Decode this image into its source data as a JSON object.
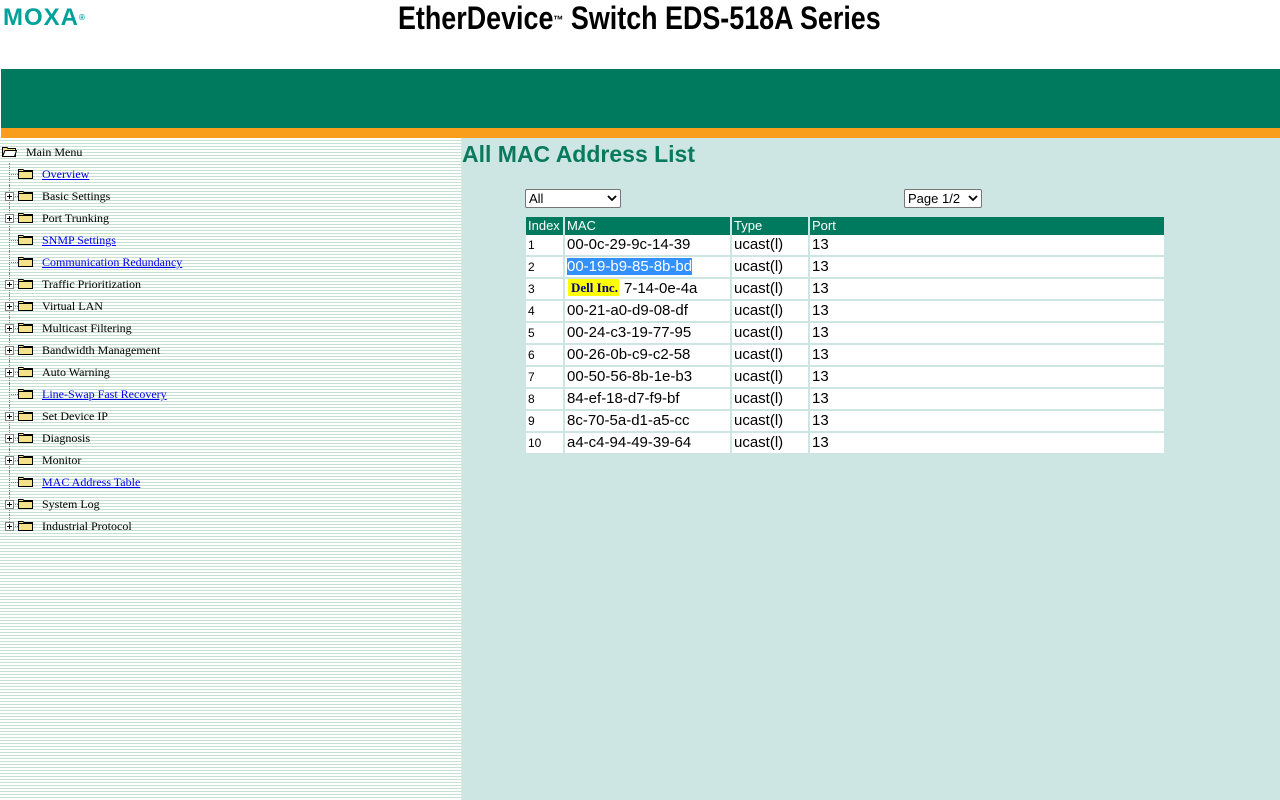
{
  "header": {
    "logo": "MOXA",
    "logo_reg": "®",
    "product_title": "EtherDevice",
    "product_tm": "™",
    "product_title_rest": " Switch EDS-518A Series"
  },
  "colors": {
    "brand_green": "#007a5e",
    "accent_orange": "#f99d1c",
    "content_bg": "#cde6e3",
    "logo_teal": "#00a19a",
    "tooltip_yellow": "#ffff00"
  },
  "sidebar": {
    "root_label": "Main Menu",
    "items": [
      {
        "label": "Overview",
        "type": "link",
        "expandable": false
      },
      {
        "label": "Basic Settings",
        "type": "folder",
        "expandable": true
      },
      {
        "label": "Port Trunking",
        "type": "folder",
        "expandable": true
      },
      {
        "label": "SNMP Settings",
        "type": "link",
        "expandable": false
      },
      {
        "label": "Communication Redundancy",
        "type": "link",
        "expandable": false
      },
      {
        "label": "Traffic Prioritization",
        "type": "folder",
        "expandable": true
      },
      {
        "label": "Virtual LAN",
        "type": "folder",
        "expandable": true
      },
      {
        "label": "Multicast Filtering",
        "type": "folder",
        "expandable": true
      },
      {
        "label": "Bandwidth Management",
        "type": "folder",
        "expandable": true
      },
      {
        "label": "Auto Warning",
        "type": "folder",
        "expandable": true
      },
      {
        "label": "Line-Swap Fast Recovery",
        "type": "link",
        "expandable": false
      },
      {
        "label": "Set Device IP",
        "type": "folder",
        "expandable": true
      },
      {
        "label": "Diagnosis",
        "type": "folder",
        "expandable": true
      },
      {
        "label": "Monitor",
        "type": "folder",
        "expandable": true
      },
      {
        "label": "MAC Address Table",
        "type": "link",
        "expandable": false
      },
      {
        "label": "System Log",
        "type": "folder",
        "expandable": true
      },
      {
        "label": "Industrial Protocol",
        "type": "folder",
        "expandable": true
      }
    ]
  },
  "main": {
    "heading": "All MAC Address List",
    "filter_select": {
      "selected": "All"
    },
    "page_select": {
      "selected": "Page 1/2"
    },
    "table": {
      "columns": [
        "Index",
        "MAC",
        "Type",
        "Port"
      ],
      "rows": [
        [
          "1",
          "00-0c-29-9c-14-39",
          "ucast(l)",
          "13"
        ],
        [
          "2",
          "00-19-b9-85-8b-bd",
          "ucast(l)",
          "13"
        ],
        [
          "3",
          "00-1b-21-47-14-0e-4a",
          "ucast(l)",
          "13"
        ],
        [
          "4",
          "00-21-a0-d9-08-df",
          "ucast(l)",
          "13"
        ],
        [
          "5",
          "00-24-c3-19-77-95",
          "ucast(l)",
          "13"
        ],
        [
          "6",
          "00-26-0b-c9-c2-58",
          "ucast(l)",
          "13"
        ],
        [
          "7",
          "00-50-56-8b-1e-b3",
          "ucast(l)",
          "13"
        ],
        [
          "8",
          "84-ef-18-d7-f9-bf",
          "ucast(l)",
          "13"
        ],
        [
          "9",
          "8c-70-5a-d1-a5-cc",
          "ucast(l)",
          "13"
        ],
        [
          "10",
          "a4-c4-94-49-39-64",
          "ucast(l)",
          "13"
        ]
      ],
      "row3_visible_mac": "7-14-0e-4a",
      "selected_row_index": 1
    },
    "tooltip": {
      "text": "Dell Inc."
    }
  }
}
